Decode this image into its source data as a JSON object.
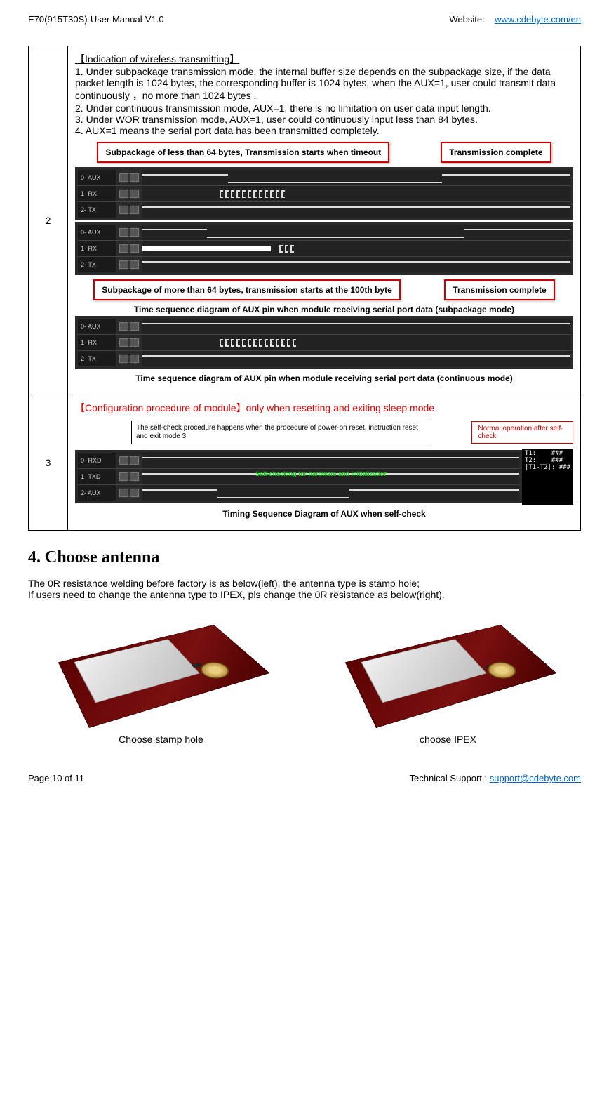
{
  "header": {
    "left": "E70(915T30S)-User Manual-V1.0",
    "right_label": "Website:",
    "right_link": "www.cdebyte.com/en"
  },
  "row2": {
    "num": "2",
    "title": "【Indication of wireless transmitting】",
    "p1": "1. Under subpackage transmission mode, the internal buffer size depends on the subpackage size, if the data packet length is 1024 bytes, the corresponding buffer is 1024 bytes, when the AUX=1, user could transmit data continuously ，no more than 1024 bytes .",
    "p2": "2. Under continuous transmission mode, AUX=1, there is no limitation   on user data input length.",
    "p3": "3. Under WOR transmission mode, AUX=1, user could continuously input less than 84 bytes.",
    "p4": "4. AUX=1 means the serial port data has been transmitted completely.",
    "callout1": "Subpackage of less than 64 bytes, Transmission starts when timeout",
    "callout2": "Transmission complete",
    "callout3": "Subpackage of more than 64 bytes, transmission starts at the 100th byte",
    "callout4": "Transmission complete",
    "wf_labels": {
      "aux": "0- AUX",
      "rx": "1- RX",
      "tx": "2- TX"
    },
    "caption1": "Time sequence diagram of AUX pin when module receiving serial port data (subpackage mode)",
    "caption2": "Time sequence diagram of AUX pin when module receiving serial port data (continuous mode)"
  },
  "row3": {
    "num": "3",
    "title": "【Configuration procedure of module】only when resetting and exiting sleep mode",
    "selfcheck_note": "The self-check procedure happens when the procedure of power-on reset, instruction reset and exit mode 3.",
    "normal_note": "Normal operation after self-check",
    "green_note": "Self-checking for hardware and initialization",
    "wf_labels": {
      "rxd": "0- RXD",
      "txd": "1- TXD",
      "aux": "2- AUX"
    },
    "readout": {
      "t1": "T1:",
      "t2": "T2:",
      "diff": "|T1-T2|:",
      "val": "###"
    },
    "caption": "Timing Sequence Diagram of AUX when self-check"
  },
  "section4": {
    "heading": "4. Choose antenna",
    "p1": "The 0R resistance welding before factory is as below(left), the antenna type is stamp hole;",
    "p2": "If users need to change the antenna type to IPEX, pls change the 0R resistance as below(right).",
    "label_left": "Choose stamp hole",
    "label_right": "choose IPEX"
  },
  "footer": {
    "left": "Page 10 of 11",
    "right_label": "Technical Support : ",
    "right_link": "support@cdebyte.com"
  }
}
